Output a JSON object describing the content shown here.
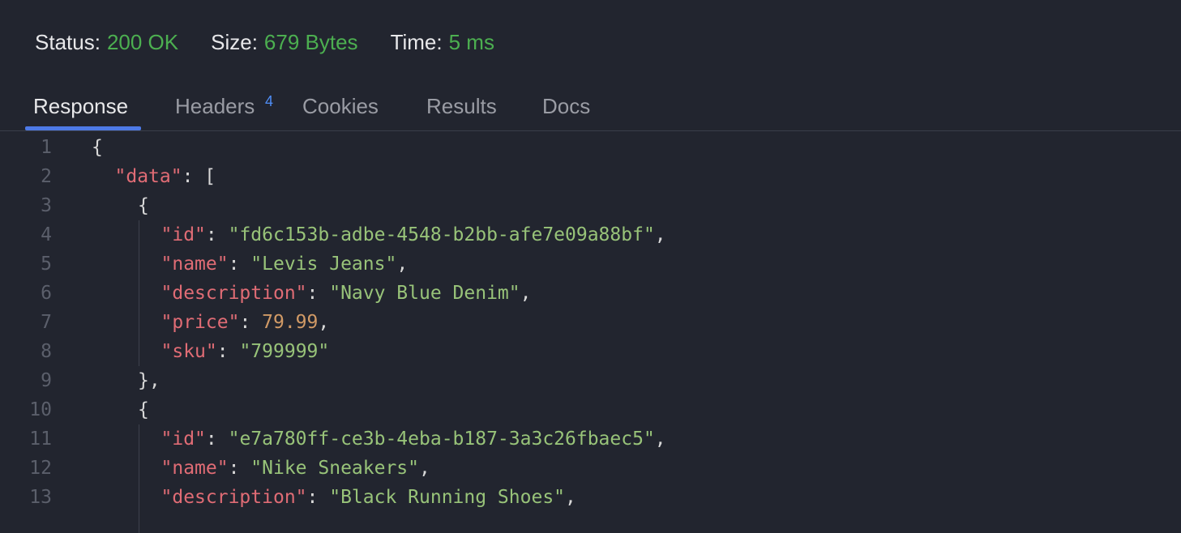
{
  "status": {
    "status_label": "Status:",
    "status_value": "200 OK",
    "size_label": "Size:",
    "size_value": "679 Bytes",
    "time_label": "Time:",
    "time_value": "5 ms"
  },
  "tabs": [
    {
      "label": "Response",
      "active": true
    },
    {
      "label": "Headers",
      "badge": "4"
    },
    {
      "label": "Cookies"
    },
    {
      "label": "Results"
    },
    {
      "label": "Docs"
    }
  ],
  "code": [
    {
      "n": "1",
      "indent": 0,
      "tokens": [
        {
          "t": "punc",
          "v": "{"
        }
      ]
    },
    {
      "n": "2",
      "indent": 1,
      "tokens": [
        {
          "t": "key",
          "v": "\"data\""
        },
        {
          "t": "punc",
          "v": ": ["
        }
      ]
    },
    {
      "n": "3",
      "indent": 2,
      "tokens": [
        {
          "t": "punc",
          "v": "{"
        }
      ]
    },
    {
      "n": "4",
      "indent": 3,
      "tokens": [
        {
          "t": "key",
          "v": "\"id\""
        },
        {
          "t": "punc",
          "v": ": "
        },
        {
          "t": "str",
          "v": "\"fd6c153b-adbe-4548-b2bb-afe7e09a88bf\""
        },
        {
          "t": "punc",
          "v": ","
        }
      ]
    },
    {
      "n": "5",
      "indent": 3,
      "tokens": [
        {
          "t": "key",
          "v": "\"name\""
        },
        {
          "t": "punc",
          "v": ": "
        },
        {
          "t": "str",
          "v": "\"Levis Jeans\""
        },
        {
          "t": "punc",
          "v": ","
        }
      ]
    },
    {
      "n": "6",
      "indent": 3,
      "tokens": [
        {
          "t": "key",
          "v": "\"description\""
        },
        {
          "t": "punc",
          "v": ": "
        },
        {
          "t": "str",
          "v": "\"Navy Blue Denim\""
        },
        {
          "t": "punc",
          "v": ","
        }
      ]
    },
    {
      "n": "7",
      "indent": 3,
      "tokens": [
        {
          "t": "key",
          "v": "\"price\""
        },
        {
          "t": "punc",
          "v": ": "
        },
        {
          "t": "num",
          "v": "79.99"
        },
        {
          "t": "punc",
          "v": ","
        }
      ]
    },
    {
      "n": "8",
      "indent": 3,
      "tokens": [
        {
          "t": "key",
          "v": "\"sku\""
        },
        {
          "t": "punc",
          "v": ": "
        },
        {
          "t": "str",
          "v": "\"799999\""
        }
      ]
    },
    {
      "n": "9",
      "indent": 2,
      "tokens": [
        {
          "t": "punc",
          "v": "},"
        }
      ]
    },
    {
      "n": "10",
      "indent": 2,
      "tokens": [
        {
          "t": "punc",
          "v": "{"
        }
      ]
    },
    {
      "n": "11",
      "indent": 3,
      "tokens": [
        {
          "t": "key",
          "v": "\"id\""
        },
        {
          "t": "punc",
          "v": ": "
        },
        {
          "t": "str",
          "v": "\"e7a780ff-ce3b-4eba-b187-3a3c26fbaec5\""
        },
        {
          "t": "punc",
          "v": ","
        }
      ]
    },
    {
      "n": "12",
      "indent": 3,
      "tokens": [
        {
          "t": "key",
          "v": "\"name\""
        },
        {
          "t": "punc",
          "v": ": "
        },
        {
          "t": "str",
          "v": "\"Nike Sneakers\""
        },
        {
          "t": "punc",
          "v": ","
        }
      ]
    },
    {
      "n": "13",
      "indent": 3,
      "tokens": [
        {
          "t": "key",
          "v": "\"description\""
        },
        {
          "t": "punc",
          "v": ": "
        },
        {
          "t": "str",
          "v": "\"Black Running Shoes\""
        },
        {
          "t": "punc",
          "v": ","
        }
      ]
    }
  ]
}
